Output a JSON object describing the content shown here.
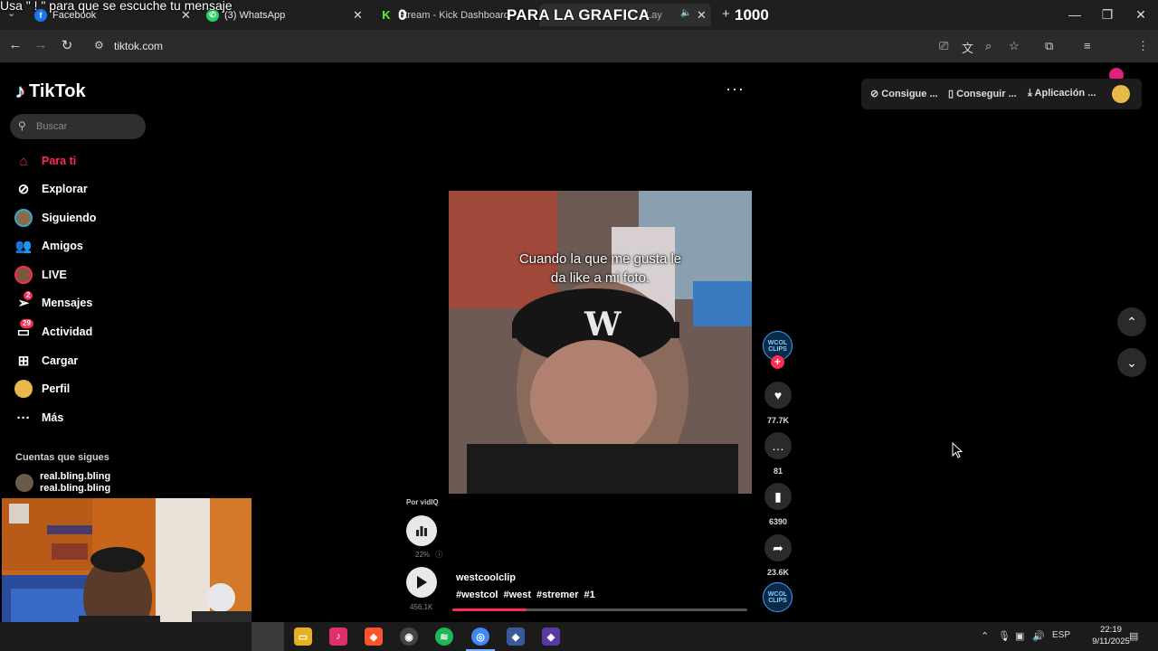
{
  "tabs": [
    {
      "label": "Facebook",
      "icon": "facebook-icon",
      "color": "#1877f2"
    },
    {
      "label": "(3) WhatsApp",
      "icon": "whatsapp-icon",
      "color": "#25d366"
    },
    {
      "label": "Stream - Kick Dashboard",
      "icon": "kick-icon",
      "color": "#53fc18"
    },
    {
      "label": "Lay",
      "icon": "tiktok-tab-icon",
      "color": "#ffffff"
    }
  ],
  "overlays": {
    "top_message": "Usa \" ! \" para que se escuche tu mensaje",
    "mid_text": "PARA LA GRAFICA",
    "counter_zero": "0",
    "counter": "1000"
  },
  "address_bar": {
    "url": "tiktok.com"
  },
  "tiktok": {
    "logo_text": "TikTok",
    "search_placeholder": "Buscar",
    "nav": [
      {
        "label": "Para ti",
        "icon": "home-icon",
        "active": true
      },
      {
        "label": "Explorar",
        "icon": "compass-icon"
      },
      {
        "label": "Siguiendo",
        "icon": "following-avatar-icon"
      },
      {
        "label": "Amigos",
        "icon": "friends-icon"
      },
      {
        "label": "LIVE",
        "icon": "live-icon"
      },
      {
        "label": "Mensajes",
        "icon": "messages-icon",
        "badge": "2"
      },
      {
        "label": "Actividad",
        "icon": "activity-icon",
        "badge": "29"
      },
      {
        "label": "Cargar",
        "icon": "upload-icon"
      },
      {
        "label": "Perfil",
        "icon": "profile-avatar-icon"
      },
      {
        "label": "Más",
        "icon": "more-icon"
      }
    ],
    "following_title": "Cuentas que sigues",
    "following_account": {
      "name": "real.bling.bling",
      "handle": "real.bling.bling"
    },
    "top_buttons": [
      {
        "label": "Consigue ...",
        "icon": "coin-icon"
      },
      {
        "label": "Conseguir ...",
        "icon": "phone-icon"
      },
      {
        "label": "Aplicación ...",
        "icon": "download-icon"
      }
    ]
  },
  "video": {
    "caption_line1": "Cuando la que me gusta le",
    "caption_line2": "da like a mi foto.",
    "author_avatar_text": "WCOL CLIPS",
    "likes": "77.7K",
    "comments": "81",
    "saves": "6390",
    "shares": "23.6K",
    "author": "westcoolclip",
    "tags": [
      "#westcol",
      "#west",
      "#stremer",
      "#1"
    ],
    "progress_fraction": 0.25
  },
  "vidiq": {
    "label": "Por vidIQ",
    "percent": "22%",
    "views": "456.1K"
  },
  "taskbar": {
    "language": "ESP",
    "time": "22:19",
    "date": "9/11/2025"
  },
  "colors": {
    "accent": "#fe2c55",
    "background": "#000000"
  }
}
